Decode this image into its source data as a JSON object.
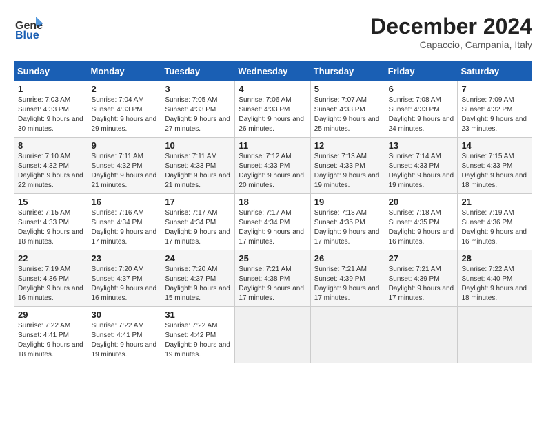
{
  "logo": {
    "line1": "General",
    "line2": "Blue"
  },
  "title": "December 2024",
  "location": "Capaccio, Campania, Italy",
  "days_of_week": [
    "Sunday",
    "Monday",
    "Tuesday",
    "Wednesday",
    "Thursday",
    "Friday",
    "Saturday"
  ],
  "weeks": [
    [
      {
        "day": "1",
        "sunrise": "7:03 AM",
        "sunset": "4:33 PM",
        "daylight": "9 hours and 30 minutes."
      },
      {
        "day": "2",
        "sunrise": "7:04 AM",
        "sunset": "4:33 PM",
        "daylight": "9 hours and 29 minutes."
      },
      {
        "day": "3",
        "sunrise": "7:05 AM",
        "sunset": "4:33 PM",
        "daylight": "9 hours and 27 minutes."
      },
      {
        "day": "4",
        "sunrise": "7:06 AM",
        "sunset": "4:33 PM",
        "daylight": "9 hours and 26 minutes."
      },
      {
        "day": "5",
        "sunrise": "7:07 AM",
        "sunset": "4:33 PM",
        "daylight": "9 hours and 25 minutes."
      },
      {
        "day": "6",
        "sunrise": "7:08 AM",
        "sunset": "4:33 PM",
        "daylight": "9 hours and 24 minutes."
      },
      {
        "day": "7",
        "sunrise": "7:09 AM",
        "sunset": "4:32 PM",
        "daylight": "9 hours and 23 minutes."
      }
    ],
    [
      {
        "day": "8",
        "sunrise": "7:10 AM",
        "sunset": "4:32 PM",
        "daylight": "9 hours and 22 minutes."
      },
      {
        "day": "9",
        "sunrise": "7:11 AM",
        "sunset": "4:32 PM",
        "daylight": "9 hours and 21 minutes."
      },
      {
        "day": "10",
        "sunrise": "7:11 AM",
        "sunset": "4:33 PM",
        "daylight": "9 hours and 21 minutes."
      },
      {
        "day": "11",
        "sunrise": "7:12 AM",
        "sunset": "4:33 PM",
        "daylight": "9 hours and 20 minutes."
      },
      {
        "day": "12",
        "sunrise": "7:13 AM",
        "sunset": "4:33 PM",
        "daylight": "9 hours and 19 minutes."
      },
      {
        "day": "13",
        "sunrise": "7:14 AM",
        "sunset": "4:33 PM",
        "daylight": "9 hours and 19 minutes."
      },
      {
        "day": "14",
        "sunrise": "7:15 AM",
        "sunset": "4:33 PM",
        "daylight": "9 hours and 18 minutes."
      }
    ],
    [
      {
        "day": "15",
        "sunrise": "7:15 AM",
        "sunset": "4:33 PM",
        "daylight": "9 hours and 18 minutes."
      },
      {
        "day": "16",
        "sunrise": "7:16 AM",
        "sunset": "4:34 PM",
        "daylight": "9 hours and 17 minutes."
      },
      {
        "day": "17",
        "sunrise": "7:17 AM",
        "sunset": "4:34 PM",
        "daylight": "9 hours and 17 minutes."
      },
      {
        "day": "18",
        "sunrise": "7:17 AM",
        "sunset": "4:34 PM",
        "daylight": "9 hours and 17 minutes."
      },
      {
        "day": "19",
        "sunrise": "7:18 AM",
        "sunset": "4:35 PM",
        "daylight": "9 hours and 17 minutes."
      },
      {
        "day": "20",
        "sunrise": "7:18 AM",
        "sunset": "4:35 PM",
        "daylight": "9 hours and 16 minutes."
      },
      {
        "day": "21",
        "sunrise": "7:19 AM",
        "sunset": "4:36 PM",
        "daylight": "9 hours and 16 minutes."
      }
    ],
    [
      {
        "day": "22",
        "sunrise": "7:19 AM",
        "sunset": "4:36 PM",
        "daylight": "9 hours and 16 minutes."
      },
      {
        "day": "23",
        "sunrise": "7:20 AM",
        "sunset": "4:37 PM",
        "daylight": "9 hours and 16 minutes."
      },
      {
        "day": "24",
        "sunrise": "7:20 AM",
        "sunset": "4:37 PM",
        "daylight": "9 hours and 15 minutes."
      },
      {
        "day": "25",
        "sunrise": "7:21 AM",
        "sunset": "4:38 PM",
        "daylight": "9 hours and 17 minutes."
      },
      {
        "day": "26",
        "sunrise": "7:21 AM",
        "sunset": "4:39 PM",
        "daylight": "9 hours and 17 minutes."
      },
      {
        "day": "27",
        "sunrise": "7:21 AM",
        "sunset": "4:39 PM",
        "daylight": "9 hours and 17 minutes."
      },
      {
        "day": "28",
        "sunrise": "7:22 AM",
        "sunset": "4:40 PM",
        "daylight": "9 hours and 18 minutes."
      }
    ],
    [
      {
        "day": "29",
        "sunrise": "7:22 AM",
        "sunset": "4:41 PM",
        "daylight": "9 hours and 18 minutes."
      },
      {
        "day": "30",
        "sunrise": "7:22 AM",
        "sunset": "4:41 PM",
        "daylight": "9 hours and 19 minutes."
      },
      {
        "day": "31",
        "sunrise": "7:22 AM",
        "sunset": "4:42 PM",
        "daylight": "9 hours and 19 minutes."
      },
      null,
      null,
      null,
      null
    ]
  ]
}
